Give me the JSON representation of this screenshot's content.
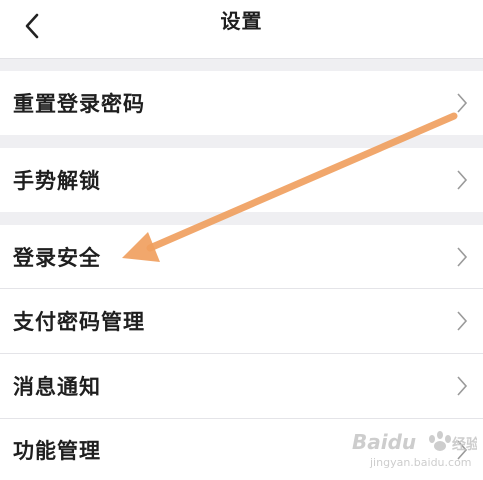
{
  "header": {
    "title": "设置",
    "back_icon": "chevron-left-icon"
  },
  "settings": [
    {
      "label": "重置登录密码",
      "icon": "chevron-right-icon"
    },
    {
      "label": "手势解锁",
      "icon": "chevron-right-icon"
    },
    {
      "label": "登录安全",
      "icon": "chevron-right-icon"
    },
    {
      "label": "支付密码管理",
      "icon": "chevron-right-icon"
    },
    {
      "label": "消息通知",
      "icon": "chevron-right-icon"
    },
    {
      "label": "功能管理",
      "icon": "chevron-right-icon"
    }
  ],
  "annotation": {
    "arrow_color": "#f0a060",
    "points_to": "登录安全"
  },
  "watermark": {
    "brand": "Baidu",
    "text": "经验",
    "url": "jingyan.baidu.com"
  }
}
